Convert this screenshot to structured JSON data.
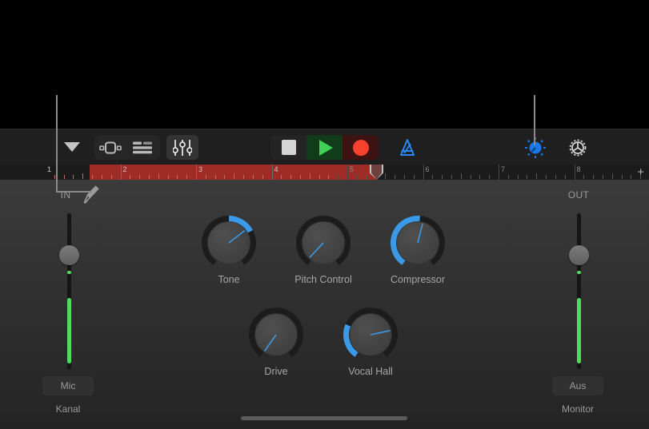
{
  "app": {
    "platform_bar": "ios-status-black-area"
  },
  "toolbar": {
    "disclosure": {
      "name": "disclosure-triangle",
      "icon": "chevron-down-icon"
    },
    "view_buttons": [
      {
        "name": "tracks-view",
        "icon": "track-cell-icon",
        "active": false
      },
      {
        "name": "list-view",
        "icon": "list-lines-icon",
        "active": false
      }
    ],
    "mixer_button": {
      "name": "mixer",
      "icon": "faders-icon",
      "active": true
    },
    "transport": [
      {
        "name": "stop",
        "icon": "stop-square-icon",
        "label": "Stop"
      },
      {
        "name": "play",
        "icon": "play-triangle-icon",
        "label": "Play"
      },
      {
        "name": "record",
        "icon": "record-circle-icon",
        "label": "Record"
      }
    ],
    "metronome": {
      "name": "metronome",
      "icon": "metronome-icon",
      "active": true
    },
    "tuner": {
      "name": "tuner",
      "icon": "tuner-knob-icon",
      "active": true
    },
    "settings": {
      "name": "settings",
      "icon": "gear-icon"
    }
  },
  "ruler": {
    "bars": [
      "1",
      "2",
      "3",
      "4",
      "5",
      "6",
      "7",
      "8"
    ],
    "cycle_region": {
      "start_bar": 1,
      "end_bar": 4.6
    },
    "playhead_bar": "4.6",
    "add_button": "+"
  },
  "input_strip": {
    "title": "IN",
    "icon": "microphone-icon",
    "button_label": "Mic",
    "sub_label": "Kanal",
    "meter_color": "#4ddc5c"
  },
  "output_strip": {
    "title": "OUT",
    "button_label": "Aus",
    "sub_label": "Monitor",
    "meter_color": "#4ddc5c"
  },
  "knobs": [
    {
      "name": "tone",
      "label": "Tone",
      "arc_start": 0,
      "arc_sweep": 62,
      "pointer_deg": 52,
      "has_arc": true
    },
    {
      "name": "pitch-control",
      "label": "Pitch Control",
      "arc_start": 0,
      "arc_sweep": 0,
      "pointer_deg": -137,
      "has_arc": false
    },
    {
      "name": "compressor",
      "label": "Compressor",
      "arc_start": -145,
      "arc_sweep": 150,
      "pointer_deg": 14,
      "has_arc": true
    },
    {
      "name": "drive",
      "label": "Drive",
      "arc_start": 0,
      "arc_sweep": 0,
      "pointer_deg": -145,
      "has_arc": false
    },
    {
      "name": "vocal-hall",
      "label": "Vocal Hall",
      "arc_start": -145,
      "arc_sweep": 78,
      "pointer_deg": 78,
      "has_arc": true
    }
  ],
  "colors": {
    "accent_blue": "#3b9ae8",
    "play_green": "#3ed155",
    "record_red": "#f6422f",
    "cycle_red": "#9e2b25",
    "meter_green": "#4ddc5c",
    "toolbar_bg": "#1f1f1f"
  }
}
